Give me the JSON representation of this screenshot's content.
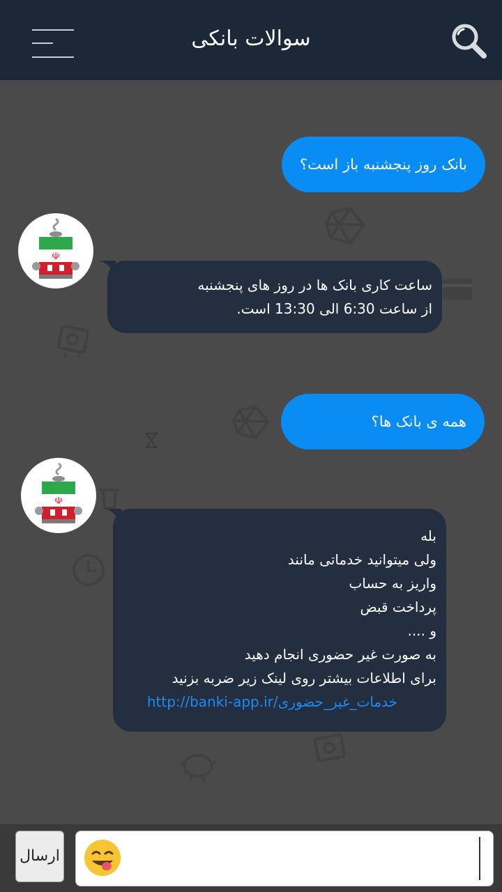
{
  "header": {
    "title": "سوالات بانکی",
    "menu_icon": "hamburger-menu-icon",
    "search_icon": "search-icon",
    "bg_color": "#1c2837"
  },
  "messages": [
    {
      "from": "user",
      "text": "بانک روز پنجشنبه باز است؟"
    },
    {
      "from": "bot",
      "lines": [
        "ساعت کاری بانک ها در روز های پنجشنبه",
        "از ساعت 6:30 الی 13:30 است."
      ]
    },
    {
      "from": "user",
      "text": "همه ی بانک ها؟"
    },
    {
      "from": "bot",
      "lines": [
        "بله",
        "ولی میتوانید خدماتی مانند",
        "واریز به حساب",
        "پرداخت قبض",
        "و ....",
        "به صورت غیر حضوری انجام دهید",
        "برای اطلاعات بیشتر روی لینک زیر ضربه بزنید"
      ],
      "link": "http://banki-app.ir/خدمات_غیر_حضوری"
    }
  ],
  "composer": {
    "send_label": "ارسال",
    "emoji_icon": "emoji-tongue-icon",
    "input_value": ""
  },
  "colors": {
    "user_bubble": "#0a8cf5",
    "bot_bubble": "#232f40",
    "chat_bg": "#4a4a4a",
    "link": "#1a8cf0"
  }
}
